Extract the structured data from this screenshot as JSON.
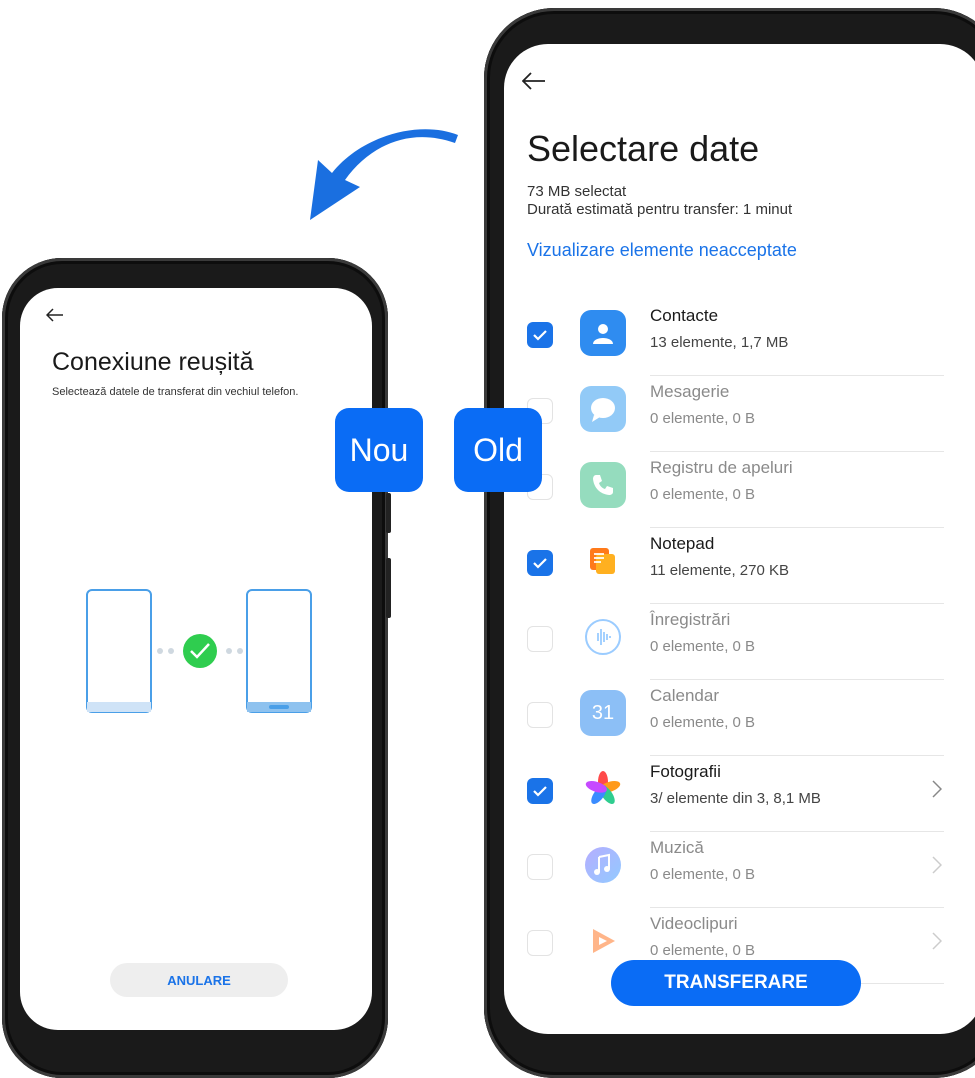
{
  "new_phone": {
    "tag": "Nou",
    "title": "Conexiune reușită",
    "subtitle": "Selectează datele de transferat din vechiul telefon.",
    "cancel_label": "ANULARE"
  },
  "old_phone": {
    "tag": "Old",
    "title": "Selectare date",
    "selected_size": "73 MB selectat",
    "estimated_duration": "Durată estimată pentru transfer: 1 minut",
    "unsupported_link": "Vizualizare elemente neacceptate",
    "items": [
      {
        "name": "Contacte",
        "detail": "13 elemente, 1,7 MB",
        "checked": true,
        "icon": "contacts-icon"
      },
      {
        "name": "Mesagerie",
        "detail": "0 elemente, 0 B",
        "checked": false,
        "icon": "messages-icon"
      },
      {
        "name": "Registru de apeluri",
        "detail": "0 elemente, 0 B",
        "checked": false,
        "icon": "phone-icon"
      },
      {
        "name": "Notepad",
        "detail": "11 elemente, 270 KB",
        "checked": true,
        "icon": "notepad-icon"
      },
      {
        "name": "Înregistrări",
        "detail": "0 elemente, 0 B",
        "checked": false,
        "icon": "recorder-icon"
      },
      {
        "name": "Calendar",
        "detail": "0 elemente, 0 B",
        "checked": false,
        "icon": "calendar-icon",
        "icon_text": "31"
      },
      {
        "name": "Fotografii",
        "detail": "3/ elemente din 3, 8,1 MB",
        "checked": true,
        "icon": "photos-icon"
      },
      {
        "name": "Muzică",
        "detail": "0 elemente, 0 B",
        "checked": false,
        "icon": "music-icon"
      },
      {
        "name": "Videoclipuri",
        "detail": "0 elemente, 0 B",
        "checked": false,
        "icon": "video-icon"
      }
    ],
    "transfer_label": "TRANSFERARE"
  },
  "colors": {
    "accent": "#0a6cf5",
    "link": "#1a73e8",
    "success": "#2fcd4f",
    "arrow": "#1a6fe0"
  }
}
